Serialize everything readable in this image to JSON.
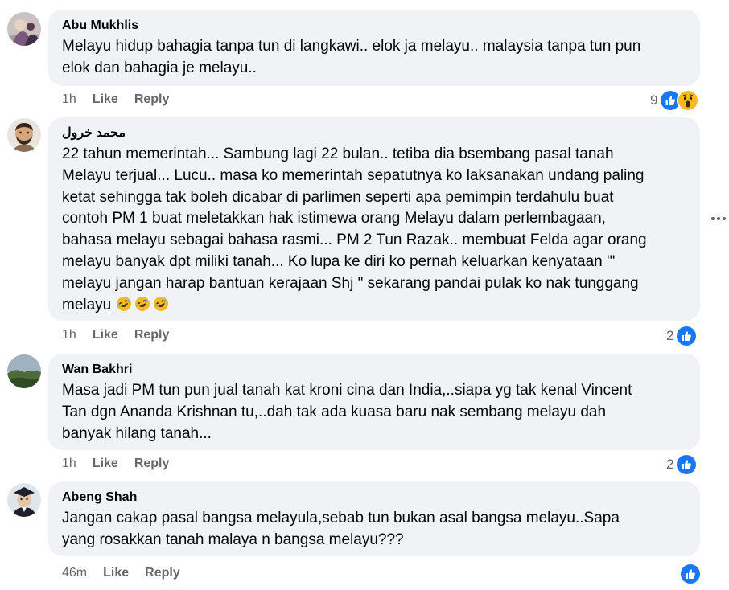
{
  "comments": [
    {
      "author": "Abu Mukhlis",
      "text": "Melayu hidup bahagia tanpa tun di langkawi.. elok ja melayu.. malaysia tanpa tun pun\nelok dan bahagia je melayu..",
      "time": "1h",
      "like_label": "Like",
      "reply_label": "Reply",
      "reaction_count": "9",
      "reactions": [
        "like-icon",
        "wow-icon"
      ]
    },
    {
      "author": "محمد خرول",
      "text": "22 tahun memerintah... Sambung lagi 22 bulan.. tetiba dia bsembang pasal tanah\nMelayu terjual... Lucu.. masa ko memerintah sepatutnya ko laksanakan undang paling\nketat sehingga tak boleh dicabar di parlimen seperti apa pemimpin terdahulu buat\ncontoh PM 1 buat meletakkan hak istimewa orang Melayu dalam perlembagaan,\nbahasa melayu sebagai bahasa rasmi... PM 2 Tun Razak.. membuat Felda agar orang\nmelayu banyak dpt miliki tanah... Ko lupa ke diri ko pernah keluarkan kenyataan '\"\nmelayu jangan harap bantuan kerajaan Shj \" sekarang pandai pulak ko nak tunggang\nmelayu ",
      "emoji_suffix": [
        "rofl-emoji",
        "rofl-emoji",
        "rofl-emoji"
      ],
      "time": "1h",
      "like_label": "Like",
      "reply_label": "Reply",
      "reaction_count": "2",
      "reactions": [
        "like-icon"
      ]
    },
    {
      "author": "Wan Bakhri",
      "text": "Masa jadi PM tun pun jual tanah kat kroni cina dan India,..siapa yg tak kenal Vincent\nTan dgn Ananda Krishnan tu,..dah tak ada kuasa baru nak sembang melayu dah\nbanyak hilang tanah...",
      "time": "1h",
      "like_label": "Like",
      "reply_label": "Reply",
      "reaction_count": "2",
      "reactions": [
        "like-icon"
      ]
    },
    {
      "author": "Abeng Shah",
      "text": "Jangan cakap pasal bangsa melayula,sebab tun bukan asal bangsa melayu..Sapa\nyang rosakkan tanah malaya n bangsa melayu???",
      "time": "46m",
      "like_label": "Like",
      "reply_label": "Reply",
      "reaction_count": "",
      "reactions": [
        "like-icon"
      ]
    }
  ],
  "colors": {
    "bubble": "#f0f2f5",
    "meta_text": "#65676b",
    "like_blue": "#1877f2",
    "wow_yellow": "#f7b928"
  },
  "icons": {
    "more": "more-options-icon"
  }
}
